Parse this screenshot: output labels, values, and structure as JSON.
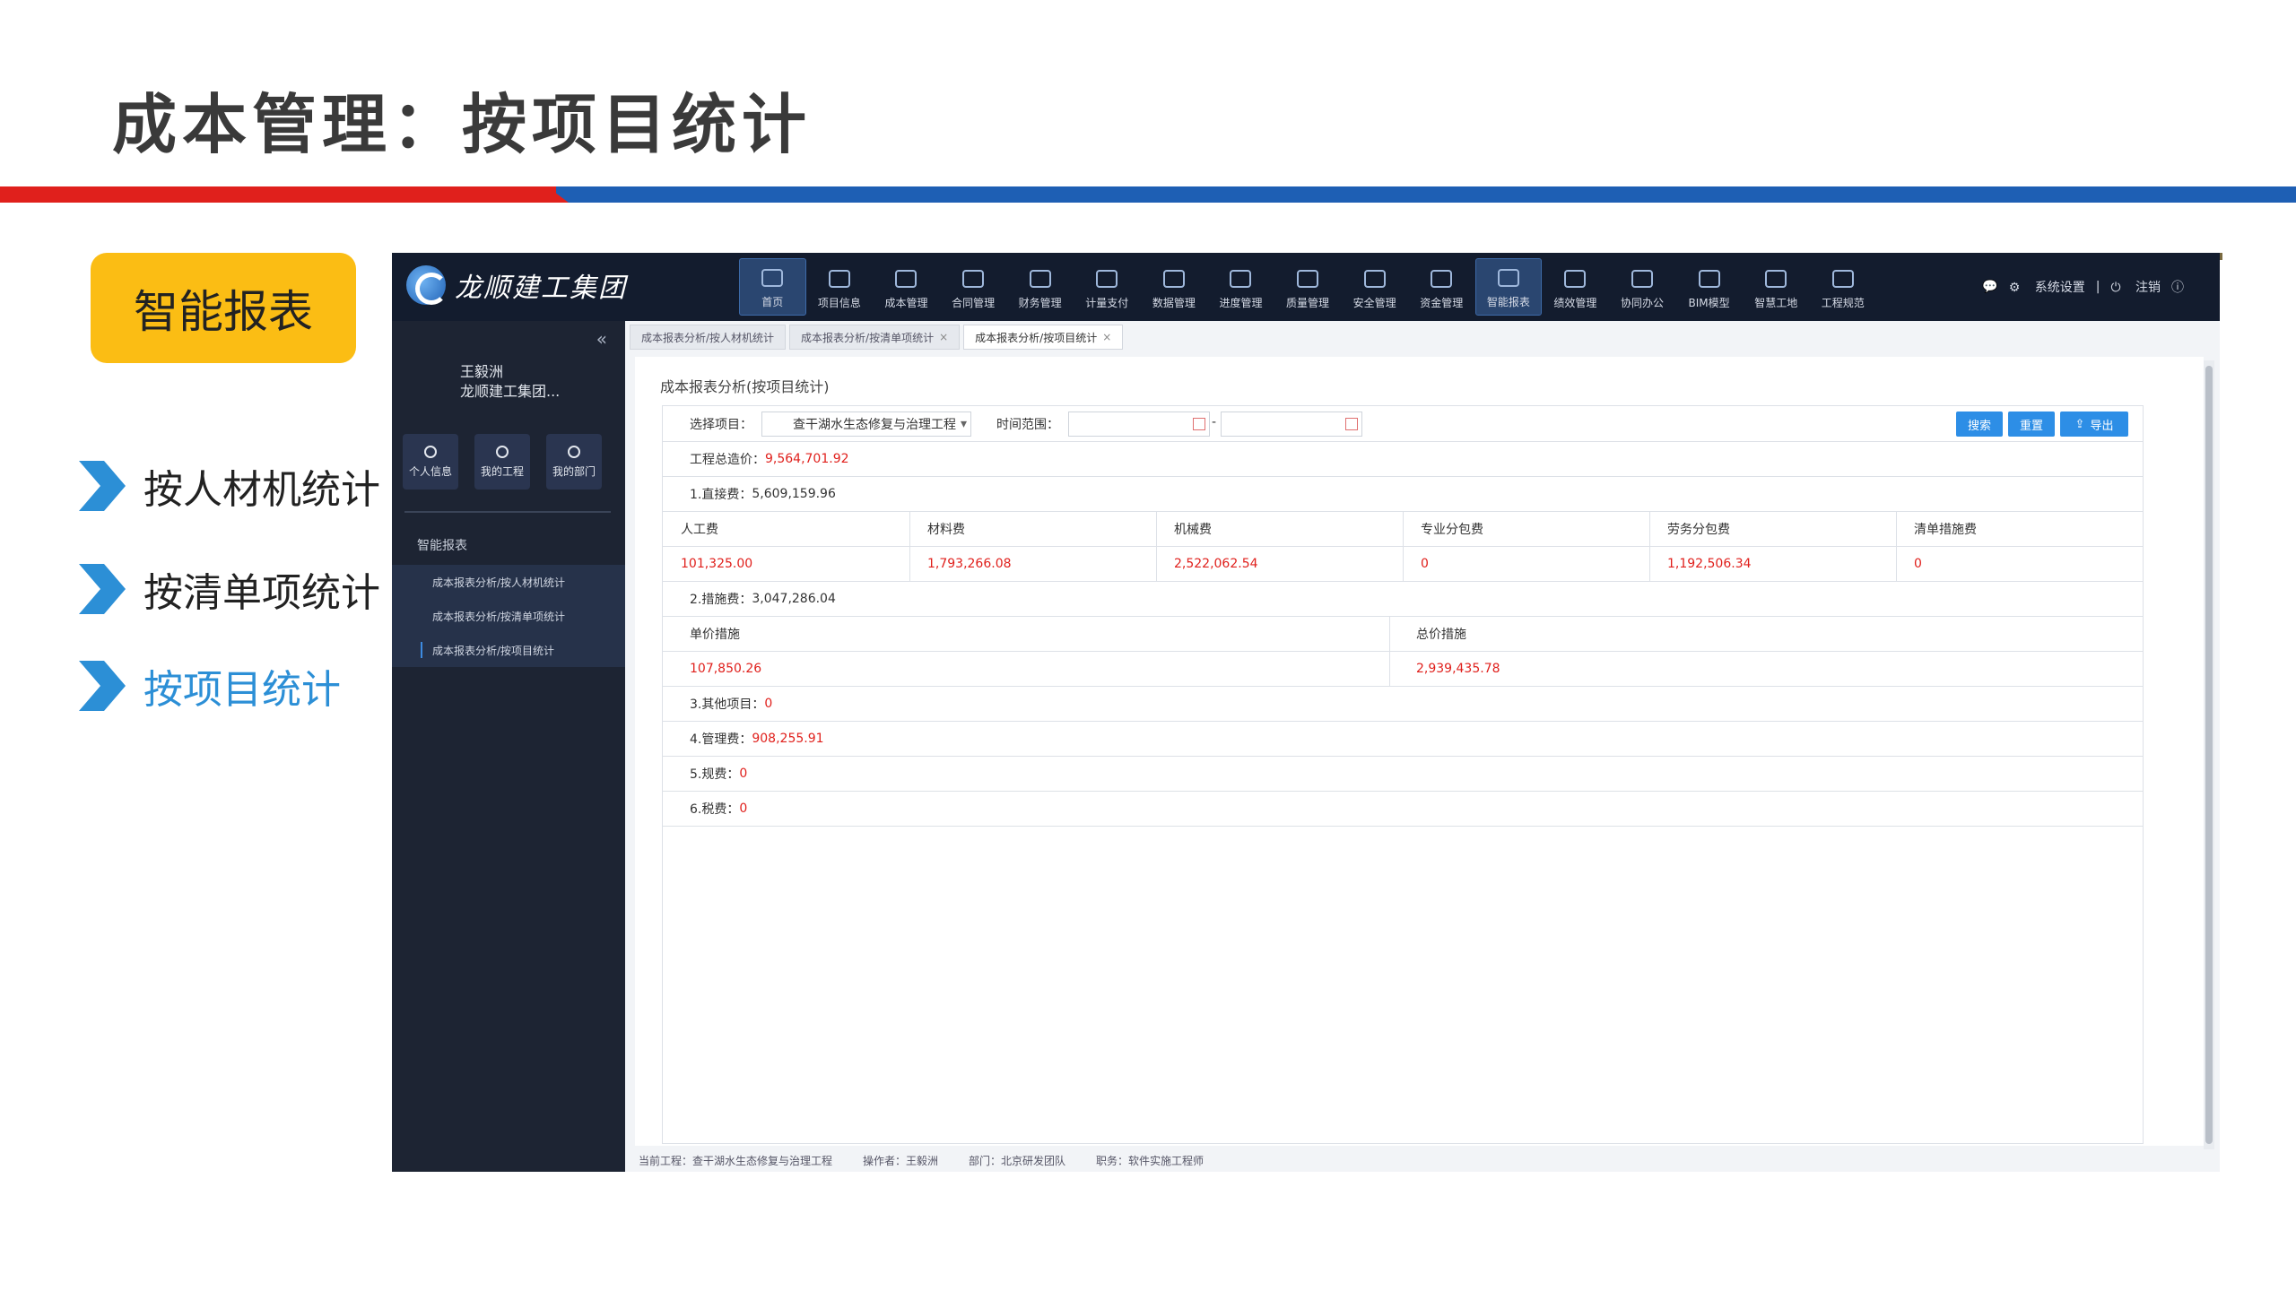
{
  "slide": {
    "title": "成本管理：按项目统计",
    "badge": "智能报表",
    "side_items": [
      {
        "label": "按人材机统计",
        "active": false
      },
      {
        "label": "按清单项统计",
        "active": false
      },
      {
        "label": "按项目统计",
        "active": true
      }
    ],
    "colors": {
      "red": "#e0201c",
      "blue": "#1e5fb4",
      "badge": "#fbbd14",
      "active_text": "#2c8fd6"
    }
  },
  "app": {
    "logo_text": "龙顺建工集团",
    "nav": [
      {
        "label": "首页",
        "icon": "monitor-icon",
        "active": true
      },
      {
        "label": "项目信息",
        "icon": "helmet-icon"
      },
      {
        "label": "成本管理",
        "icon": "building-icon"
      },
      {
        "label": "合同管理",
        "icon": "contract-icon"
      },
      {
        "label": "财务管理",
        "icon": "finance-icon"
      },
      {
        "label": "计量支付",
        "icon": "payment-icon"
      },
      {
        "label": "数据管理",
        "icon": "data-icon"
      },
      {
        "label": "进度管理",
        "icon": "progress-icon"
      },
      {
        "label": "质量管理",
        "icon": "shield-icon"
      },
      {
        "label": "安全管理",
        "icon": "safety-helmet-icon"
      },
      {
        "label": "资金管理",
        "icon": "money-icon"
      },
      {
        "label": "智能报表",
        "icon": "report-icon",
        "active": true
      },
      {
        "label": "绩效管理",
        "icon": "performance-icon"
      },
      {
        "label": "协同办公",
        "icon": "collab-icon"
      },
      {
        "label": "BIM模型",
        "icon": "bim-icon"
      },
      {
        "label": "智慧工地",
        "icon": "gear-icon"
      },
      {
        "label": "工程规范",
        "icon": "ruler-icon"
      }
    ],
    "top_right": {
      "chat": "💬",
      "settings": "系统设置",
      "logout": "注销",
      "info": "ⓘ"
    },
    "sidebar": {
      "collapse": "«",
      "user_name": "王毅洲",
      "user_org": "龙顺建工集团...",
      "quick": [
        "个人信息",
        "我的工程",
        "我的部门"
      ],
      "menu_head": "智能报表",
      "menu_items": [
        {
          "label": "成本报表分析/按人材机统计"
        },
        {
          "label": "成本报表分析/按清单项统计"
        },
        {
          "label": "成本报表分析/按项目统计",
          "active": true
        }
      ]
    },
    "tabs": [
      {
        "label": "成本报表分析/按人材机统计",
        "closable": false
      },
      {
        "label": "成本报表分析/按清单项统计",
        "closable": true
      },
      {
        "label": "成本报表分析/按项目统计",
        "closable": true,
        "active": true
      }
    ],
    "pane_title": "成本报表分析(按项目统计)",
    "filter": {
      "project_label": "选择项目：",
      "project_value": "查干湖水生态修复与治理工程",
      "time_label": "时间范围：",
      "time_sep": "-",
      "search_btn": "搜索",
      "reset_btn": "重置",
      "export_btn": "导出"
    },
    "summary": {
      "total_label": "工程总造价：",
      "total_value": "9,564,701.92",
      "direct_label": "1.直接费：",
      "direct_value": "5,609,159.96",
      "direct_headers": [
        "人工费",
        "材料费",
        "机械费",
        "专业分包费",
        "劳务分包费",
        "清单措施费"
      ],
      "direct_values": [
        "101,325.00",
        "1,793,266.08",
        "2,522,062.54",
        "0",
        "1,192,506.34",
        "0"
      ],
      "measure_label": "2.措施费：",
      "measure_value": "3,047,286.04",
      "measure_headers": [
        "单价措施",
        "总价措施"
      ],
      "measure_values": [
        "107,850.26",
        "2,939,435.78"
      ],
      "other_label": "3.其他项目：",
      "other_value": "0",
      "mgmt_label": "4.管理费：",
      "mgmt_value": "908,255.91",
      "fee_label": "5.规费：",
      "fee_value": "0",
      "tax_label": "6.税费：",
      "tax_value": "0"
    },
    "status": {
      "project": "当前工程：查干湖水生态修复与治理工程",
      "operator": "操作者：王毅洲",
      "dept": "部门：北京研发团队",
      "role": "职务：软件实施工程师"
    }
  }
}
